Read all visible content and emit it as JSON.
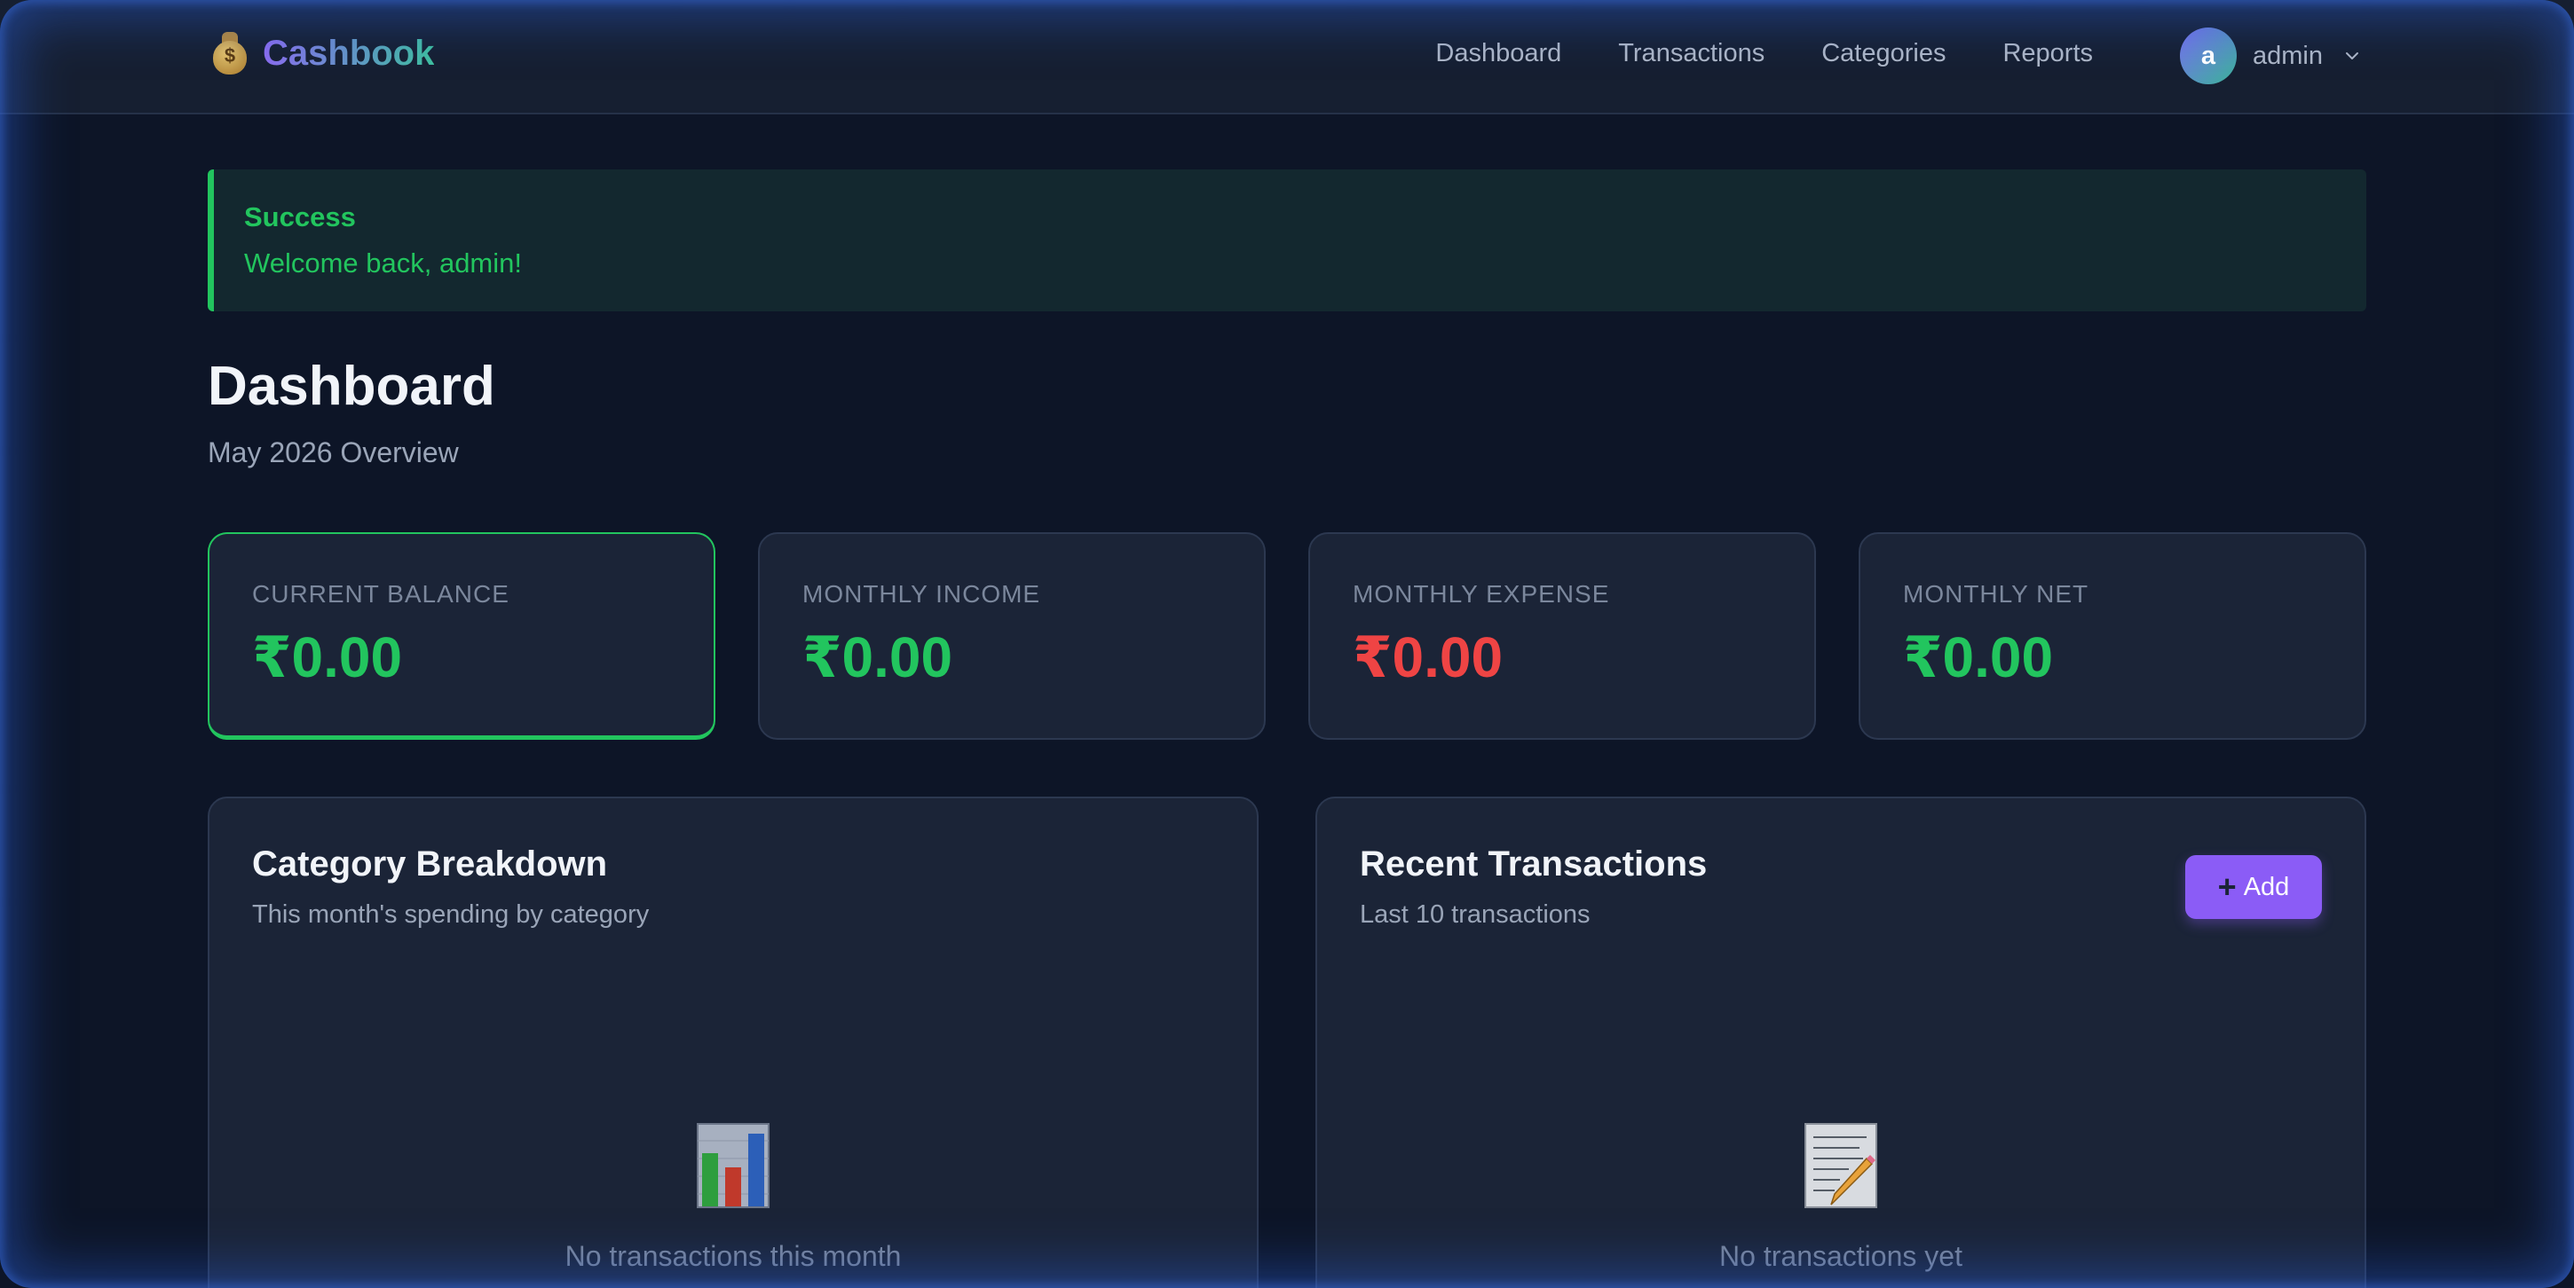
{
  "brand": {
    "name": "Cashbook",
    "icon": "money-bag-icon"
  },
  "nav": {
    "links": [
      "Dashboard",
      "Transactions",
      "Categories",
      "Reports"
    ]
  },
  "user": {
    "initial": "a",
    "name": "admin"
  },
  "alert": {
    "title": "Success",
    "message": "Welcome back, admin!"
  },
  "page": {
    "title": "Dashboard",
    "subtitle": "May 2026 Overview"
  },
  "stats": [
    {
      "label": "CURRENT BALANCE",
      "value": "₹0.00",
      "color": "#22c55e"
    },
    {
      "label": "MONTHLY INCOME",
      "value": "₹0.00",
      "color": "#22c55e"
    },
    {
      "label": "MONTHLY EXPENSE",
      "value": "₹0.00",
      "color": "#ef4444"
    },
    {
      "label": "MONTHLY NET",
      "value": "₹0.00",
      "color": "#22c55e"
    }
  ],
  "category_panel": {
    "title": "Category Breakdown",
    "subtitle": "This month's spending by category",
    "empty_text": "No transactions this month",
    "empty_icon": "bar-chart-icon"
  },
  "transactions_panel": {
    "title": "Recent Transactions",
    "subtitle": "Last 10 transactions",
    "add_label": "Add",
    "empty_text": "No transactions yet",
    "empty_icon": "memo-icon"
  },
  "colors": {
    "accent": "#8b5cf6",
    "success": "#22c55e",
    "danger": "#ef4444",
    "background": "#0d1527",
    "card": "#1b2437"
  }
}
